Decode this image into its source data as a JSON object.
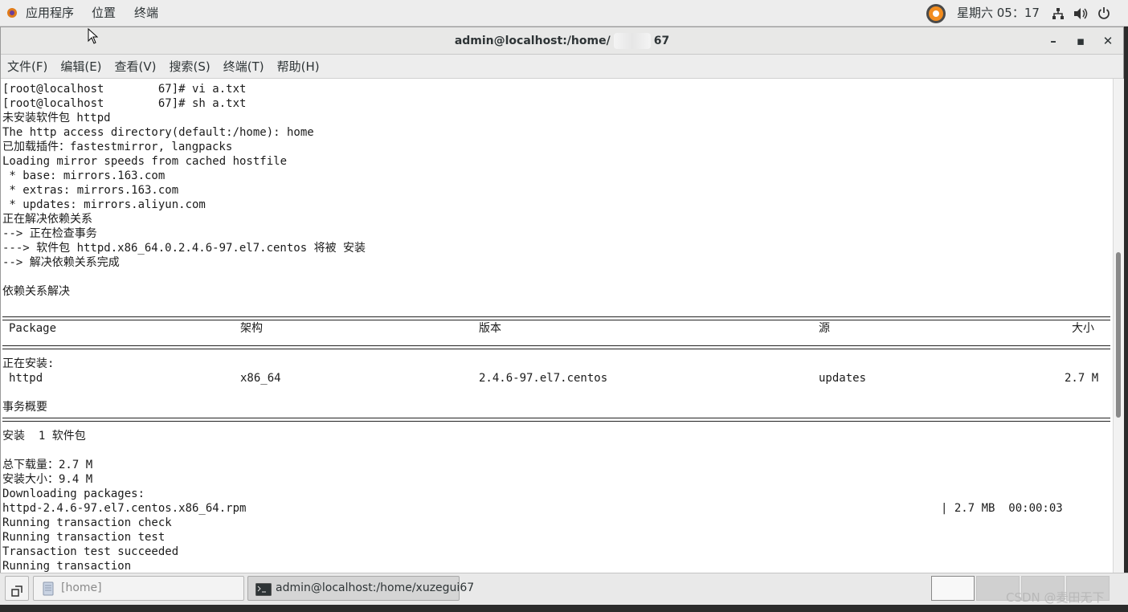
{
  "topbar": {
    "menus": [
      "应用程序",
      "位置",
      "终端"
    ],
    "clock": "星期六 05：17"
  },
  "window": {
    "title_prefix": "admin@localhost:/home/",
    "title_suffix": "67",
    "controls": {
      "minimize": "–",
      "maximize": "▪",
      "close": "✕"
    }
  },
  "menubar": [
    "文件(F)",
    "编辑(E)",
    "查看(V)",
    "搜索(S)",
    "终端(T)",
    "帮助(H)"
  ],
  "terminal": {
    "lines_top": [
      "[root@localhost        67]# vi a.txt",
      "[root@localhost        67]# sh a.txt",
      "未安装软件包 httpd",
      "The http access directory(default:/home): home",
      "已加载插件：fastestmirror, langpacks",
      "Loading mirror speeds from cached hostfile",
      " * base: mirrors.163.com",
      " * extras: mirrors.163.com",
      " * updates: mirrors.aliyun.com",
      "正在解决依赖关系",
      "--> 正在检查事务",
      "---> 软件包 httpd.x86_64.0.2.4.6-97.el7.centos 将被 安装",
      "--> 解决依赖关系完成",
      "",
      "依赖关系解决"
    ],
    "table": {
      "headers": [
        "Package",
        "架构",
        "版本",
        "源",
        "大小"
      ],
      "installing_label": "正在安装:",
      "row": [
        "httpd",
        "x86_64",
        "2.4.6-97.el7.centos",
        "updates",
        "2.7 M"
      ],
      "summary_label": "事务概要"
    },
    "lines_bottom": [
      "安装  1 软件包",
      "",
      "总下载量：2.7 M",
      "安装大小：9.4 M",
      "Downloading packages:",
      "httpd-2.4.6-97.el7.centos.x86_64.rpm",
      "Running transaction check",
      "Running transaction test",
      "Transaction test succeeded",
      "Running transaction"
    ],
    "download_progress": "| 2.7 MB  00:00:03"
  },
  "taskbar": {
    "items": [
      {
        "label": "[home]"
      },
      {
        "label": "admin@localhost:/home/xuzegui67"
      }
    ]
  },
  "watermark": "CSDN @麦田无下"
}
